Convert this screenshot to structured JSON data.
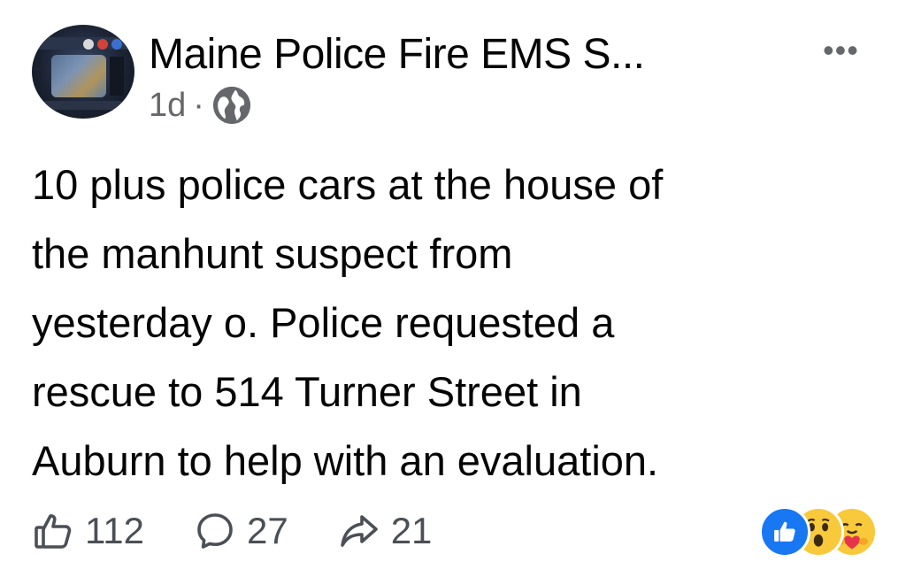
{
  "post": {
    "author": "Maine Police Fire EMS S...",
    "time": "1d",
    "separator": "·",
    "privacy_icon": "globe-icon",
    "more_label": "•••",
    "lines": [
      "10 plus police cars at the house of",
      "the manhunt suspect from",
      "yesterday o. Police requested a",
      "rescue to 514 Turner Street in",
      "Auburn to help with an evaluation."
    ]
  },
  "actions": {
    "likes": "112",
    "comments": "27",
    "shares": "21"
  },
  "reactions": [
    "like-icon",
    "wow-icon",
    "care-icon"
  ],
  "colors": {
    "text": "#050505",
    "secondary": "#65676b",
    "like_blue": "#1877f2",
    "emoji_yellow": "#f7c93b"
  }
}
